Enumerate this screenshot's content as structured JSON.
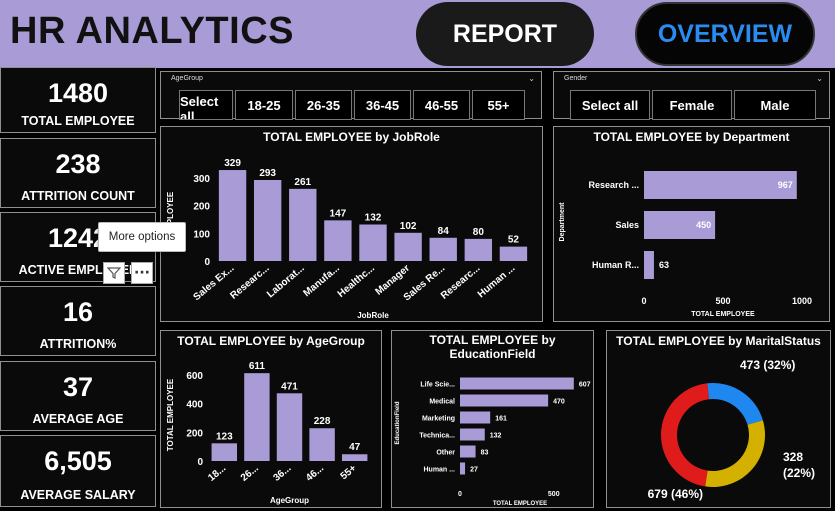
{
  "header": {
    "title": "HR ANALYTICS",
    "report_label": "REPORT",
    "overview_label": "OVERVIEW"
  },
  "kpis": [
    {
      "value": "1480",
      "label": "TOTAL EMPLOYEE"
    },
    {
      "value": "238",
      "label": "ATTRITION COUNT"
    },
    {
      "value": "1242",
      "label": "ACTIVE EMPLOYEE"
    },
    {
      "value": "16",
      "label": "ATTRITION%"
    },
    {
      "value": "37",
      "label": "AVERAGE AGE"
    },
    {
      "value": "6,505",
      "label": "AVERAGE SALARY"
    }
  ],
  "tooltip": {
    "text": "More options"
  },
  "slicers": {
    "age": {
      "caption": "AgeGroup",
      "options": [
        "Select all",
        "18-25",
        "26-35",
        "36-45",
        "46-55",
        "55+"
      ]
    },
    "gender": {
      "caption": "Gender",
      "options": [
        "Select all",
        "Female",
        "Male"
      ]
    }
  },
  "colors": {
    "bar": "#a99bd6",
    "header": "#a99bd6",
    "overview_text": "#2a8cf0",
    "donut": [
      "#e01b1b",
      "#1e88f0",
      "#d4b000"
    ]
  },
  "chart_data": [
    {
      "id": "jobrole",
      "type": "bar",
      "title": "TOTAL EMPLOYEE by JobRole",
      "xlabel": "JobRole",
      "ylabel": "EMPLOYEE",
      "categories": [
        "Sales Ex...",
        "Researc...",
        "Laborat...",
        "Manufa...",
        "Healthc...",
        "Manager",
        "Sales Re...",
        "Researc...",
        "Human ..."
      ],
      "values": [
        329,
        293,
        261,
        147,
        132,
        102,
        84,
        80,
        52
      ],
      "yticks": [
        0,
        100,
        200,
        300
      ],
      "ylim": [
        0,
        340
      ]
    },
    {
      "id": "department",
      "type": "bar",
      "orientation": "horizontal",
      "title": "TOTAL EMPLOYEE by Department",
      "xlabel": "TOTAL EMPLOYEE",
      "ylabel": "Department",
      "categories": [
        "Research ...",
        "Sales",
        "Human R..."
      ],
      "values": [
        967,
        450,
        63
      ],
      "xticks": [
        0,
        500,
        1000
      ],
      "xlim": [
        0,
        1000
      ]
    },
    {
      "id": "agegroup",
      "type": "bar",
      "title": "TOTAL EMPLOYEE by AgeGroup",
      "xlabel": "AgeGroup",
      "ylabel": "TOTAL EMPLOYEE",
      "categories": [
        "18...",
        "26...",
        "36...",
        "46...",
        "55+"
      ],
      "values": [
        123,
        611,
        471,
        228,
        47
      ],
      "yticks": [
        0,
        200,
        400,
        600
      ],
      "ylim": [
        0,
        640
      ]
    },
    {
      "id": "education",
      "type": "bar",
      "orientation": "horizontal",
      "title_lines": [
        "TOTAL EMPLOYEE by",
        "EducationField"
      ],
      "xlabel": "TOTAL EMPLOYEE",
      "ylabel": "EducationField",
      "categories": [
        "Life Scie...",
        "Medical",
        "Marketing",
        "Technica...",
        "Other",
        "Human ..."
      ],
      "values": [
        607,
        470,
        161,
        132,
        83,
        27
      ],
      "xticks": [
        0,
        500
      ],
      "xlim": [
        0,
        640
      ]
    },
    {
      "id": "marital",
      "type": "pie",
      "donut": true,
      "title": "TOTAL EMPLOYEE by MaritalStatus",
      "slices": [
        {
          "value": 679,
          "label": "679 (46%)"
        },
        {
          "value": 328,
          "label_lines": [
            "328",
            "(22%)"
          ]
        },
        {
          "value": 473,
          "label": "473 (32%)"
        }
      ]
    }
  ]
}
